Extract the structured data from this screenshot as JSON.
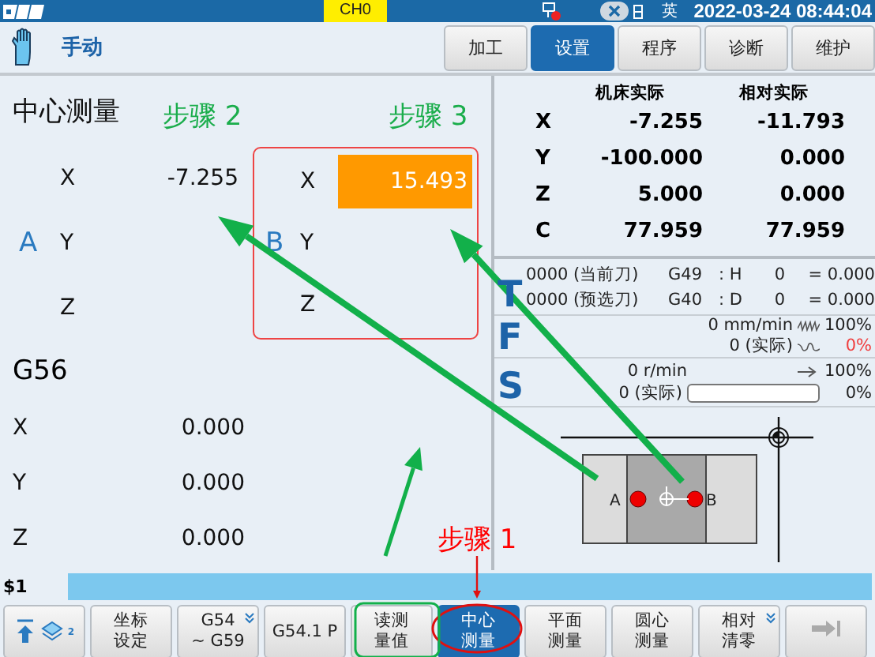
{
  "top_bar": {
    "channel": "CH0",
    "language": "英",
    "datetime": "2022-03-24 08:44:04"
  },
  "header": {
    "mode": "手动",
    "tabs": [
      {
        "label": "加工",
        "selected": false
      },
      {
        "label": "设置",
        "selected": true
      },
      {
        "label": "程序",
        "selected": false
      },
      {
        "label": "诊断",
        "selected": false
      },
      {
        "label": "维护",
        "selected": false
      }
    ]
  },
  "measure": {
    "title": "中心测量",
    "point_a": {
      "label": "A",
      "axes": [
        {
          "axis": "X",
          "value": "-7.255"
        },
        {
          "axis": "Y"
        },
        {
          "axis": "Z"
        }
      ]
    },
    "point_b": {
      "label": "B",
      "axes": [
        {
          "axis": "X",
          "value": "15.493",
          "selected": true
        },
        {
          "axis": "Y",
          "selected": false
        },
        {
          "axis": "Z",
          "selected": false
        }
      ]
    }
  },
  "offset": {
    "title": "G56",
    "axes": [
      {
        "axis": "X",
        "value": "0.000"
      },
      {
        "axis": "Y",
        "value": "0.000"
      },
      {
        "axis": "Z",
        "value": "0.000"
      }
    ]
  },
  "coordinates": {
    "columns": [
      "机床实际",
      "相对实际"
    ],
    "rows": [
      {
        "axis": "X",
        "machine": "-7.255",
        "relative": "-11.793"
      },
      {
        "axis": "Y",
        "machine": "-100.000",
        "relative": "0.000"
      },
      {
        "axis": "Z",
        "machine": "5.000",
        "relative": "0.000"
      },
      {
        "axis": "C",
        "machine": "77.959",
        "relative": "77.959"
      }
    ]
  },
  "tool": {
    "letter": "T",
    "rows": [
      {
        "tool": "0000 (当前刀)",
        "code": "G49",
        "register": ": H",
        "number": "0",
        "value": "= 0.000"
      },
      {
        "tool": "0000 (预选刀)",
        "code": "G40",
        "register": ": D",
        "number": "0",
        "value": "= 0.000"
      }
    ]
  },
  "feed": {
    "letter": "F",
    "rate": "0 mm/min",
    "override": "100%",
    "actual": "0 (实际)",
    "actual_override": "0%"
  },
  "spindle": {
    "letter": "S",
    "rate": "0 r/min",
    "override": "100%",
    "actual": "0 (实际)",
    "load": "0%",
    "level": 0
  },
  "diagram": {
    "point_a": "A",
    "point_b": "B"
  },
  "command_line": {
    "prompt": "$1"
  },
  "softkeys": [
    {
      "kind": "icons",
      "badge": "2"
    },
    {
      "kind": "key",
      "lines": [
        "坐标",
        "设定"
      ],
      "selected": false,
      "more": false
    },
    {
      "kind": "key",
      "lines": [
        "G54",
        "~ G59"
      ],
      "selected": false,
      "more": true
    },
    {
      "kind": "key",
      "lines": [
        "G54.1 P"
      ],
      "selected": false,
      "more": false
    },
    {
      "kind": "key",
      "lines": [
        "读测",
        "量值"
      ],
      "selected": false,
      "more": false
    },
    {
      "kind": "key",
      "lines": [
        "中心",
        "测量"
      ],
      "selected": true,
      "more": false
    },
    {
      "kind": "key",
      "lines": [
        "平面",
        "测量"
      ],
      "selected": false,
      "more": false
    },
    {
      "kind": "key",
      "lines": [
        "圆心",
        "测量"
      ],
      "selected": false,
      "more": false
    },
    {
      "kind": "key",
      "lines": [
        "相对",
        "清零"
      ],
      "selected": false,
      "more": true
    },
    {
      "kind": "next"
    }
  ],
  "annotations": [
    {
      "text": "步骤 2",
      "color": "#1aad4b"
    },
    {
      "text": "步骤 3",
      "color": "#1aad4b"
    },
    {
      "text": "步骤 1",
      "color": "#ff0000"
    }
  ]
}
